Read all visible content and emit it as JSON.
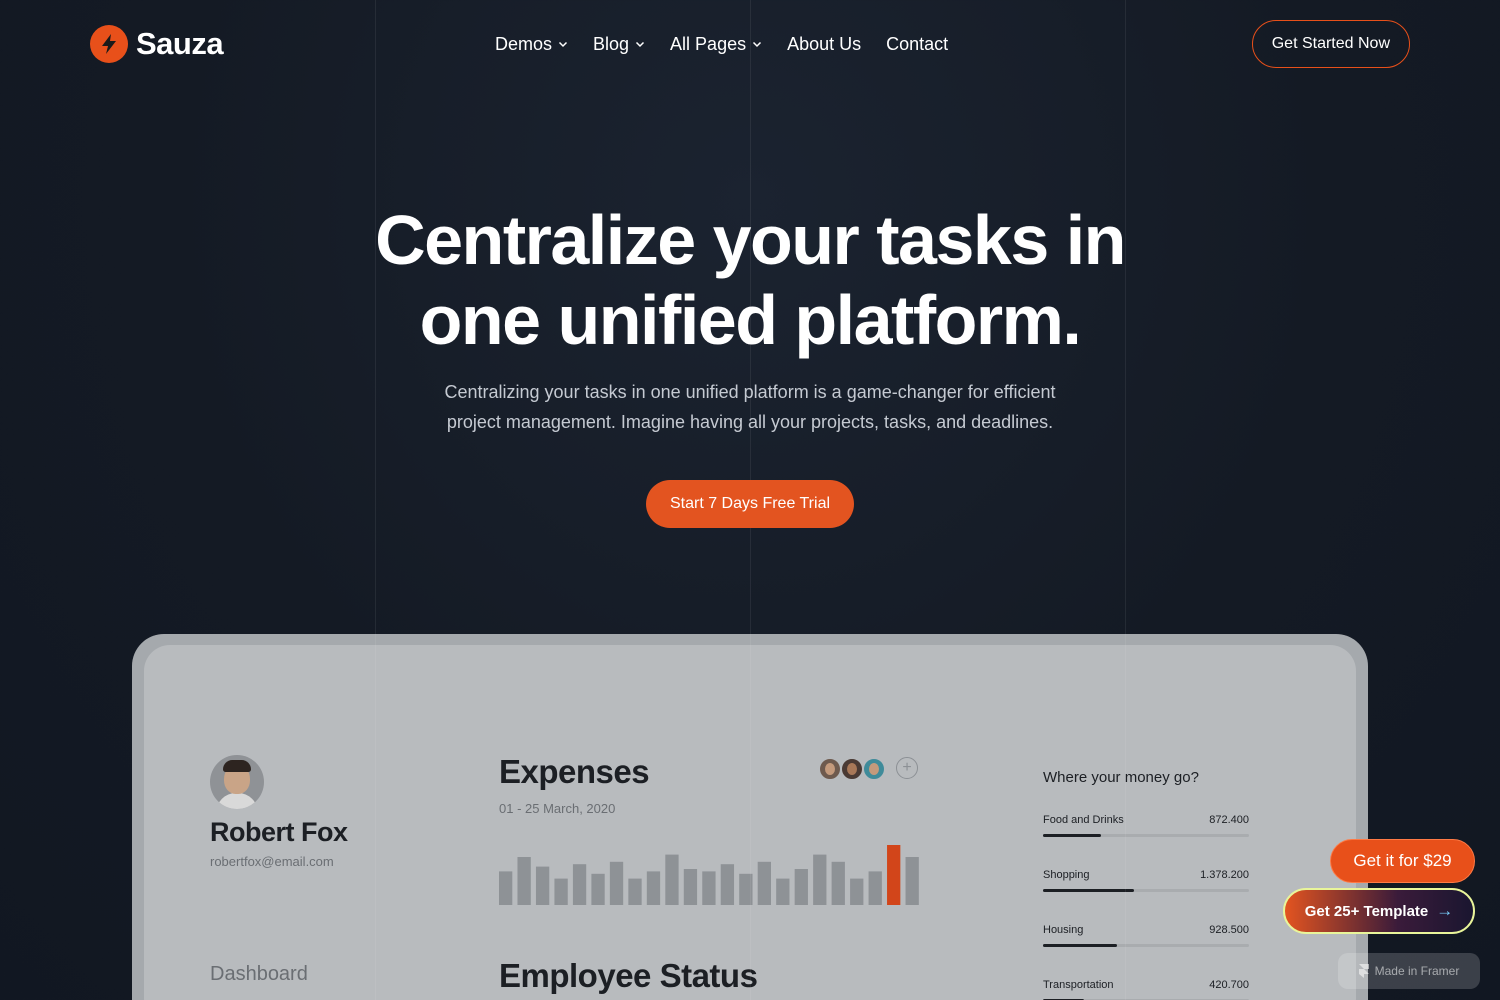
{
  "brand": {
    "name": "Sauza",
    "accent": "#e8501a"
  },
  "nav": {
    "items": [
      {
        "label": "Demos",
        "dropdown": true
      },
      {
        "label": "Blog",
        "dropdown": true
      },
      {
        "label": "All Pages",
        "dropdown": true
      },
      {
        "label": "About Us",
        "dropdown": false
      },
      {
        "label": "Contact",
        "dropdown": false
      }
    ],
    "cta": "Get Started Now"
  },
  "hero": {
    "title_line1": "Centralize your tasks in",
    "title_line2": "one unified platform.",
    "subtitle_line1": "Centralizing your tasks in one unified platform is a game-changer for efficient",
    "subtitle_line2": "project management. Imagine having all your projects, tasks, and deadlines.",
    "cta": "Start 7 Days Free Trial"
  },
  "dashboard": {
    "user": {
      "name": "Robert Fox",
      "email": "robertfox@email.com"
    },
    "sidebar_link": "Dashboard",
    "expenses": {
      "title": "Expenses",
      "date_range": "01 - 25 March, 2020",
      "add_symbol": "+"
    },
    "employee_status_title": "Employee Status",
    "money": {
      "title": "Where your money go?",
      "rows": [
        {
          "label": "Food and Drinks",
          "value": "872.400",
          "fraction": 0.28
        },
        {
          "label": "Shopping",
          "value": "1.378.200",
          "fraction": 0.44
        },
        {
          "label": "Housing",
          "value": "928.500",
          "fraction": 0.36
        },
        {
          "label": "Transportation",
          "value": "420.700",
          "fraction": 0.2
        }
      ]
    }
  },
  "chart_data": {
    "type": "bar",
    "categories": [
      "1",
      "2",
      "3",
      "4",
      "5",
      "6",
      "7",
      "8",
      "9",
      "10",
      "11",
      "12",
      "13",
      "14",
      "15",
      "16",
      "17",
      "18",
      "19",
      "20",
      "21",
      "22",
      "23"
    ],
    "values": [
      28,
      40,
      32,
      22,
      34,
      26,
      36,
      22,
      28,
      42,
      30,
      28,
      34,
      26,
      36,
      22,
      30,
      42,
      36,
      22,
      28,
      50,
      40
    ],
    "highlight_index": 21,
    "bar_color": "#8e9296",
    "highlight_color": "#d2451a",
    "ylim": [
      0,
      50
    ]
  },
  "floating": {
    "price_button": "Get it for $29",
    "template_button": "Get 25+ Template",
    "framer_badge": "Made in Framer"
  }
}
